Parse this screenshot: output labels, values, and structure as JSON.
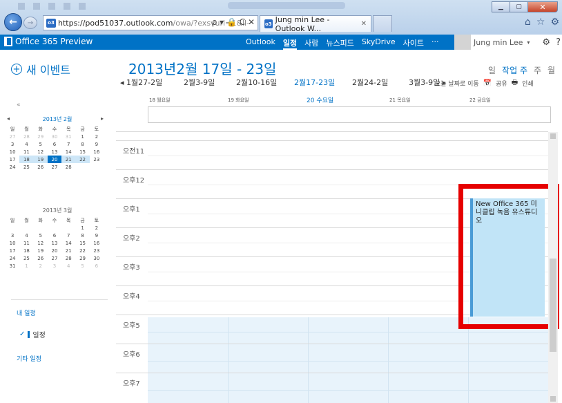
{
  "browser": {
    "url_main": "https://pod51037.outlook.com",
    "url_rest": "/owa/?exsvurl=1&ll-",
    "url_controls": "ρ ▾ 🔒 C ✕",
    "tab_label": "Jung min Lee - Outlook W...",
    "tab_close": "✕",
    "favicon_text": "o3"
  },
  "o365": {
    "product": "Office 365 Preview",
    "nav": [
      "Outlook",
      "일정",
      "사람",
      "뉴스피드",
      "SkyDrive",
      "사이트",
      "···"
    ],
    "active_nav_index": 1,
    "user": "Jung min Lee",
    "caret": "▾",
    "gear": "⚙",
    "help": "?"
  },
  "sidebar": {
    "new_event": "새 이벤트",
    "collapse": "«",
    "feb": {
      "title": "2013년 2월",
      "prev": "◂",
      "next": "▸",
      "dow": [
        "일",
        "월",
        "화",
        "수",
        "목",
        "금",
        "토"
      ],
      "weeks": [
        [
          "27",
          "28",
          "29",
          "30",
          "31",
          "1",
          "2"
        ],
        [
          "3",
          "4",
          "5",
          "6",
          "7",
          "8",
          "9"
        ],
        [
          "10",
          "11",
          "12",
          "13",
          "14",
          "15",
          "16"
        ],
        [
          "17",
          "18",
          "19",
          "20",
          "21",
          "22",
          "23"
        ],
        [
          "24",
          "25",
          "26",
          "27",
          "28",
          "",
          ""
        ]
      ]
    },
    "mar": {
      "title": "2013년 3월",
      "dow": [
        "일",
        "월",
        "화",
        "수",
        "목",
        "금",
        "토"
      ],
      "weeks": [
        [
          "",
          "",
          "",
          "",
          "",
          "1",
          "2"
        ],
        [
          "3",
          "4",
          "5",
          "6",
          "7",
          "8",
          "9"
        ],
        [
          "10",
          "11",
          "12",
          "13",
          "14",
          "15",
          "16"
        ],
        [
          "17",
          "18",
          "19",
          "20",
          "21",
          "22",
          "23"
        ],
        [
          "24",
          "25",
          "26",
          "27",
          "28",
          "29",
          "30"
        ],
        [
          "31",
          "1",
          "2",
          "3",
          "4",
          "5",
          "6"
        ]
      ]
    },
    "my_calendars": "내 일정",
    "calendar_item": "일정",
    "check": "✓",
    "other_calendars": "기타 일정"
  },
  "header": {
    "date_range": "2013년2월 17일 - 23일",
    "views": [
      "일",
      "작업 주",
      "주",
      "월"
    ],
    "active_view_index": 1,
    "weeks": [
      "◂ 1월27-2일",
      "2월3-9일",
      "2월10-16일",
      "2월17-23일",
      "2월24-2일",
      "3월3-9일 ▸"
    ],
    "today": "오늘 날짜로 이동",
    "share": "공유",
    "print": "인쇄"
  },
  "grid": {
    "days": [
      "18 월요일",
      "19 화요일",
      "20 수요일",
      "21 목요일",
      "22 금요일"
    ],
    "today_index": 2,
    "hours": [
      "오전11",
      "오후12",
      "오후1",
      "오후2",
      "오후3",
      "오후4",
      "오후5",
      "오후6",
      "오후7"
    ]
  },
  "event": {
    "title": "New Office 365 미니클립 녹음 유스튜디오"
  },
  "colors": {
    "brand": "#0072c6",
    "highlight": "#e60000",
    "event_fill": "#c1e4f7"
  }
}
